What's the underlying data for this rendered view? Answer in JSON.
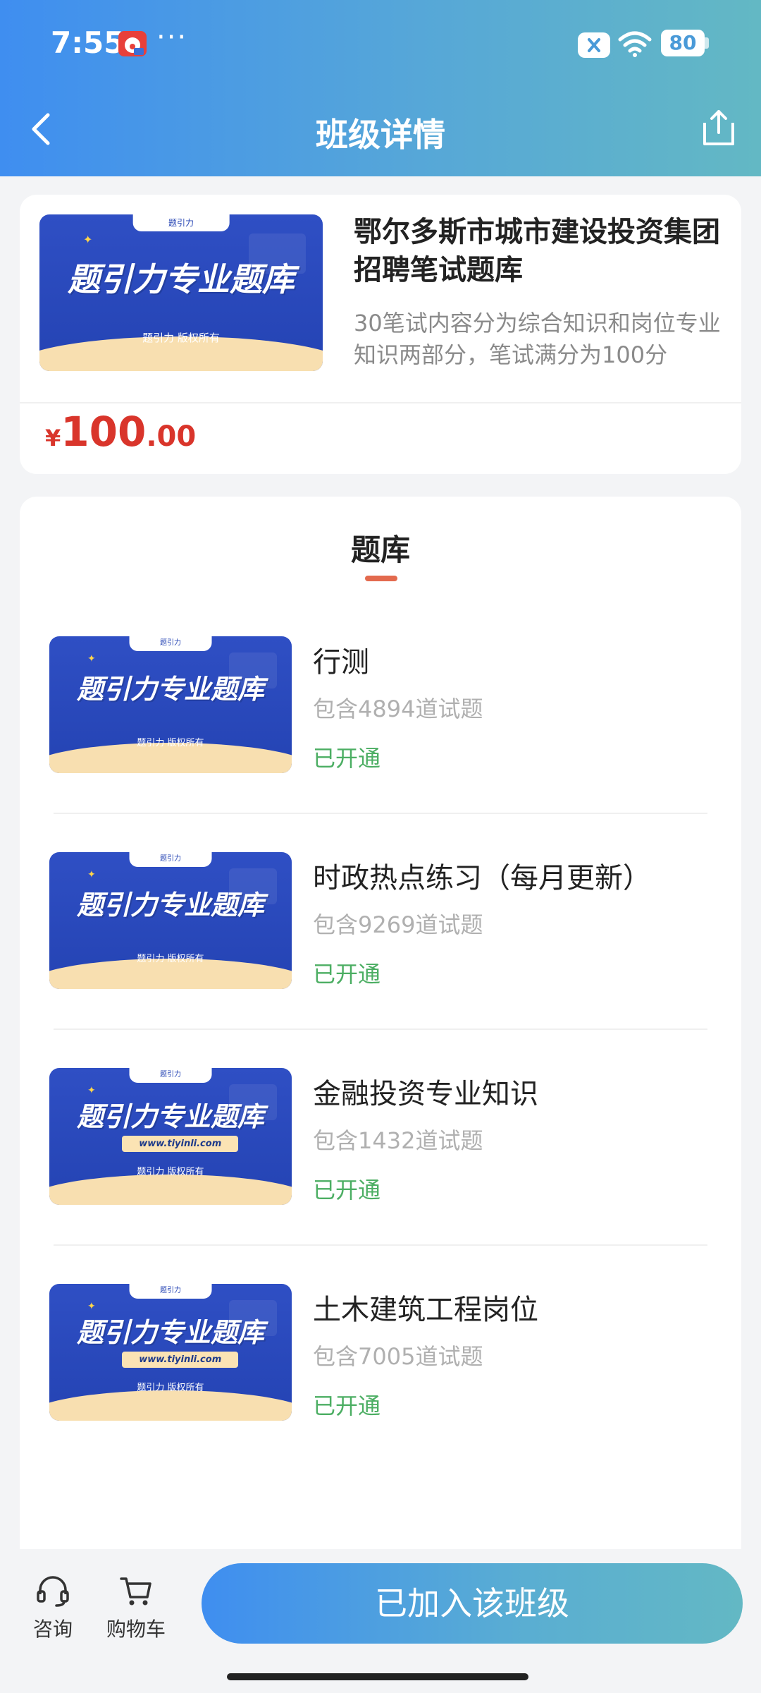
{
  "status_bar": {
    "time": "7:55",
    "more": "···",
    "battery": "80"
  },
  "header": {
    "title": "班级详情",
    "back_icon": "chevron-left-icon",
    "share_icon": "share-icon"
  },
  "product": {
    "title": "鄂尔多斯市城市建设投资集团招聘笔试题库",
    "description": "30笔试内容分为综合知识和岗位专业知识两部分，笔试满分为100分",
    "price_symbol": "¥",
    "price_integer": "100",
    "price_decimal": ".00",
    "banner": {
      "logo_text": "题引力",
      "headline": "题引力专业题库",
      "copyright": "题引力 版权所有"
    }
  },
  "bank": {
    "title": "题库",
    "items": [
      {
        "name": "行测",
        "count": "包含4894道试题",
        "status": "已开通",
        "banner": {
          "logo_text": "题引力",
          "headline": "题引力专业题库",
          "copyright": "题引力 版权所有",
          "url": ""
        }
      },
      {
        "name": "时政热点练习（每月更新）",
        "count": "包含9269道试题",
        "status": "已开通",
        "banner": {
          "logo_text": "题引力",
          "headline": "题引力专业题库",
          "copyright": "题引力 版权所有",
          "url": ""
        }
      },
      {
        "name": "金融投资专业知识",
        "count": "包含1432道试题",
        "status": "已开通",
        "banner": {
          "logo_text": "题引力",
          "headline": "题引力专业题库",
          "copyright": "题引力 版权所有",
          "url": "www.tiyinli.com"
        }
      },
      {
        "name": "土木建筑工程岗位",
        "count": "包含7005道试题",
        "status": "已开通",
        "banner": {
          "logo_text": "题引力",
          "headline": "题引力专业题库",
          "copyright": "题引力 版权所有",
          "url": "www.tiyinli.com"
        }
      }
    ]
  },
  "bottom_bar": {
    "consult_label": "咨询",
    "cart_label": "购物车",
    "join_label": "已加入该班级"
  },
  "colors": {
    "accent_start": "#3f8ef0",
    "accent_end": "#63b8c4",
    "price": "#d9352b",
    "status": "#4cae63",
    "underline": "#e36a4e"
  }
}
